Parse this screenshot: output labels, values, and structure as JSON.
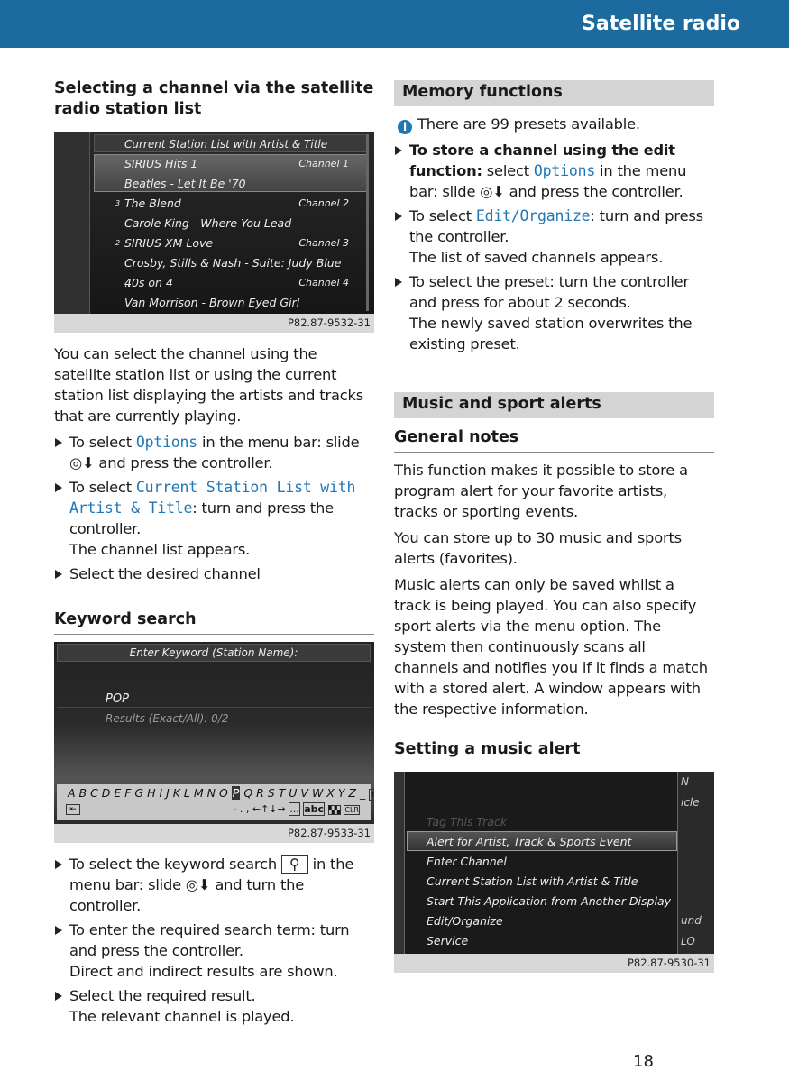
{
  "header": {
    "title": "Satellite radio"
  },
  "left": {
    "section1": {
      "title": "Selecting a channel via the satellite radio station list",
      "screen": {
        "title": "Current Station List with Artist & Title",
        "rows": [
          {
            "text": "SIRIUS Hits 1",
            "channel": "Channel 1",
            "num": ""
          },
          {
            "text": "Beatles - Let It Be '70",
            "channel": "",
            "num": ""
          },
          {
            "text": "The Blend",
            "channel": "Channel 2",
            "num": "3"
          },
          {
            "text": "Carole King - Where You Lead",
            "channel": "",
            "num": ""
          },
          {
            "text": "SIRIUS XM Love",
            "channel": "Channel 3",
            "num": "2"
          },
          {
            "text": "Crosby, Stills & Nash - Suite: Judy Blue ...",
            "channel": "",
            "num": ""
          },
          {
            "text": "40s on 4",
            "channel": "Channel 4",
            "num": ""
          },
          {
            "text": "Van Morrison - Brown Eyed Girl",
            "channel": "",
            "num": ""
          }
        ],
        "caption": "P82.87-9532-31"
      },
      "intro": "You can select the channel using the satellite station list or using the current station list displaying the artists and tracks that are currently playing.",
      "steps": [
        {
          "a": "To select ",
          "code": "Options",
          "b": " in the menu bar: slide ◎⬇ and press the controller."
        },
        {
          "a": "To select ",
          "code": "Current Station List with Artist & Title",
          "b": ": turn and press the controller.",
          "note": "The channel list appears."
        },
        {
          "a": "Select the desired channel"
        }
      ]
    },
    "section2": {
      "title": "Keyword search",
      "screen": {
        "title": "Enter Keyword (Station Name):",
        "input": "POP",
        "results": "Results (Exact/All): 0/2",
        "letters": "A B C D E F G H I J K L M N O",
        "selected_letter": "P",
        "letters_after": "Q R S T U V W X Y Z _",
        "ok": "ok",
        "row2": "- . ,  ←↑↓→",
        "k1": "...",
        "k2": "abc",
        "k3": "CLR",
        "caption": "P82.87-9533-31"
      },
      "steps": [
        {
          "a": "To select the keyword search ",
          "icon": "⚲",
          "b": " in the menu bar: slide ◎⬇ and turn the controller."
        },
        {
          "a": "To enter the required search term: turn and press the controller.",
          "note": "Direct and indirect results are shown."
        },
        {
          "a": "Select the required result.",
          "note": "The relevant channel is played."
        }
      ]
    }
  },
  "right": {
    "memory": {
      "title": "Memory functions",
      "info": "There are 99 presets available.",
      "steps": [
        {
          "bold": "To store a channel using the edit function:",
          "a": " select ",
          "code": "Options",
          "b": " in the menu bar: slide ◎⬇ and press the controller."
        },
        {
          "a": "To select ",
          "code": "Edit/Organize",
          "b": ": turn and press the controller.",
          "note": "The list of saved channels appears."
        },
        {
          "a": "To select the preset: turn the controller and press for about 2 seconds.",
          "note": "The newly saved station overwrites the existing preset."
        }
      ]
    },
    "alerts": {
      "title": "Music and sport alerts",
      "sub": "General notes",
      "paras": [
        "This function makes it possible to store a program alert for your favorite artists, tracks or sporting events.",
        "You can store up to 30 music and sports alerts (favorites).",
        "Music alerts can only be saved whilst a track is being played. You can also specify sport alerts via the menu option. The system then continuously scans all channels and notifies you if it finds a match with a stored alert. A window appears with the respective information."
      ]
    },
    "setting": {
      "title": "Setting a music alert",
      "screen": {
        "items": [
          "Tag This Track",
          "Alert for Artist, Track & Sports Event",
          "Enter Channel",
          "Current Station List with Artist & Title",
          "Start This Application from Another Display",
          "Edit/Organize",
          "Service"
        ],
        "side": [
          "N",
          "icle",
          "und",
          "LO"
        ],
        "caption": "P82.87-9530-31"
      }
    }
  },
  "page_number": "18"
}
